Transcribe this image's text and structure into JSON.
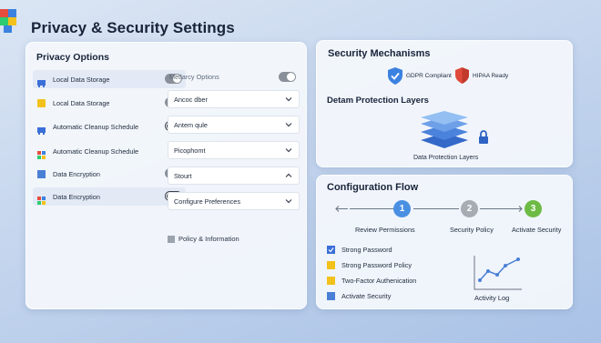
{
  "app": {
    "title": "Privacy & Security Settings"
  },
  "privacy": {
    "title": "Privacy Options",
    "options": [
      {
        "label": "Local Data Storage",
        "icon": "storage-icon",
        "color": "#3b6fd8",
        "toggle": "on",
        "highlighted": true
      },
      {
        "label": "Local Data Storage",
        "icon": "storage-icon",
        "color": "#f2c11b",
        "toggle": "on",
        "highlighted": false
      },
      {
        "label": "Automatic Cleanup Schedule",
        "icon": "cleanup-icon",
        "color": "#3b6fd8",
        "toggle": "off",
        "highlighted": false
      },
      {
        "label": "Automatic Cleanup Schedule",
        "icon": "windows-icon",
        "color": "#e74c3c",
        "toggle": "none",
        "highlighted": false
      },
      {
        "label": "Data Encryption",
        "icon": "encryption-icon",
        "color": "#4a7fd6",
        "toggle": "on",
        "highlighted": false
      },
      {
        "label": "Data Encryption",
        "icon": "windows-icon",
        "color": "#e74c3c",
        "toggle": "off",
        "highlighted": true
      }
    ],
    "meta_label": "Metlarcy Options",
    "dropdowns": [
      {
        "value": "Ancoc dber",
        "chevron": "down"
      },
      {
        "value": "Antem qule",
        "chevron": "down"
      },
      {
        "value": "Picophomt",
        "chevron": "down"
      },
      {
        "value": "Stourt",
        "chevron": "up"
      },
      {
        "value": "Configure Preferences",
        "chevron": "down"
      }
    ],
    "policy_label": "Policy & Information"
  },
  "security": {
    "title": "Security Mechanisms",
    "badges": [
      {
        "label": "GDPR Compliant",
        "icon": "shield-check-icon",
        "color": "#3b82e0"
      },
      {
        "label": "HIPAA Ready",
        "icon": "shield-icon",
        "color": "#e04a3b"
      }
    ],
    "layers_title": "Detam Protection Layers",
    "layers_caption": "Data Protection Layers"
  },
  "config": {
    "title": "Configuration Flow",
    "steps": [
      {
        "number": "1",
        "label": "Review Permissions",
        "color": "#4a90e2"
      },
      {
        "number": "2",
        "label": "Security Policy",
        "color": "#a7acb3"
      },
      {
        "number": "3",
        "label": "Activate Security",
        "color": "#6dbb45"
      }
    ],
    "checklist": [
      {
        "label": "Strong Password",
        "color": "#3b6fd8",
        "checked": true
      },
      {
        "label": "Strong Password Policy",
        "color": "#f2c11b",
        "checked": false
      },
      {
        "label": "Two-Factor Authenication",
        "color": "#f2c11b",
        "checked": false
      },
      {
        "label": "Activate Security",
        "color": "#4a7fd6",
        "checked": false
      }
    ],
    "activity_label": "Activity Log"
  }
}
